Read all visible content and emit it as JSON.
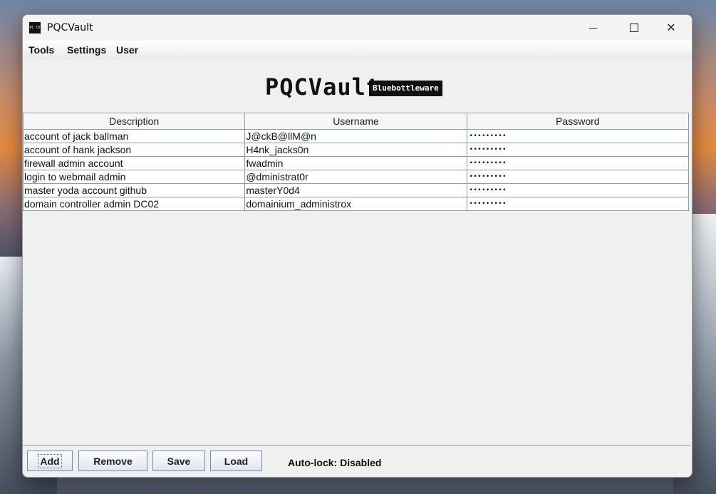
{
  "window": {
    "title": "PQCVault",
    "icon_text": "PC CV"
  },
  "menu": {
    "items": [
      "Tools",
      "Settings",
      "User"
    ]
  },
  "logo": {
    "title": "PQCVault",
    "badge": "Bluebottleware"
  },
  "table": {
    "headers": [
      "Description",
      "Username",
      "Password"
    ],
    "rows": [
      {
        "description": "account of jack ballman",
        "username": "J@ckB@llM@n",
        "password": "•••••••••"
      },
      {
        "description": "account of hank jackson",
        "username": "H4nk_jacks0n",
        "password": "•••••••••"
      },
      {
        "description": "firewall admin account",
        "username": "fwadmin",
        "password": "•••••••••"
      },
      {
        "description": "login to webmail admin",
        "username": "@dministrat0r",
        "password": "•••••••••"
      },
      {
        "description": "master yoda account github",
        "username": "masterY0d4",
        "password": "•••••••••"
      },
      {
        "description": "domain controller admin DC02",
        "username": "domainium_administrox",
        "password": "•••••••••"
      }
    ]
  },
  "toolbar": {
    "add_label": "Add",
    "remove_label": "Remove",
    "save_label": "Save",
    "load_label": "Load",
    "autolock_status": "Auto-lock: Disabled"
  }
}
